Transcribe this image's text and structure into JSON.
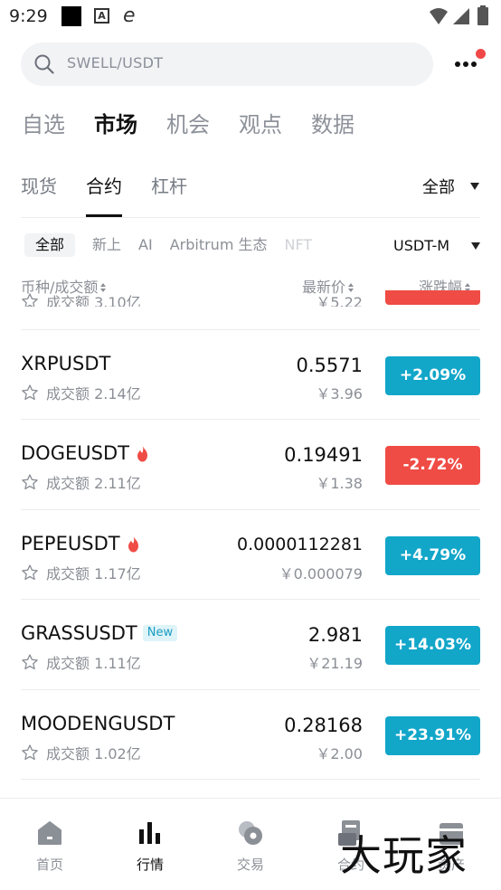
{
  "status_bar": {
    "time": "9:29"
  },
  "search": {
    "placeholder": "SWELL/USDT"
  },
  "main_tabs": [
    {
      "label": "自选",
      "active": false
    },
    {
      "label": "市场",
      "active": true
    },
    {
      "label": "机会",
      "active": false
    },
    {
      "label": "观点",
      "active": false
    },
    {
      "label": "数据",
      "active": false
    }
  ],
  "sub_tabs": [
    {
      "label": "现货",
      "active": false
    },
    {
      "label": "合约",
      "active": true
    },
    {
      "label": "杠杆",
      "active": false
    }
  ],
  "filter_all": "全部",
  "chips": [
    {
      "label": "全部",
      "active": true
    },
    {
      "label": "新上",
      "active": false
    },
    {
      "label": "AI",
      "active": false
    },
    {
      "label": "Arbitrum 生态",
      "active": false
    },
    {
      "label": "NFT",
      "active": false
    }
  ],
  "usdt_m": "USDT-M",
  "columns": {
    "name": "币种/成交额",
    "price": "最新价",
    "change": "涨跌幅"
  },
  "partial_row": {
    "volume": "成交额 3.10亿",
    "cny": "￥5.22"
  },
  "rows": [
    {
      "symbol": "XRPUSDT",
      "hot": false,
      "new": false,
      "volume": "成交额 2.14亿",
      "price": "0.5571",
      "cny": "￥3.96",
      "change": "+2.09%",
      "direction": "up"
    },
    {
      "symbol": "DOGEUSDT",
      "hot": true,
      "new": false,
      "volume": "成交额 2.11亿",
      "price": "0.19491",
      "cny": "￥1.38",
      "change": "-2.72%",
      "direction": "down"
    },
    {
      "symbol": "PEPEUSDT",
      "hot": true,
      "new": false,
      "volume": "成交额 1.17亿",
      "price": "0.0000112281",
      "cny": "￥0.000079",
      "change": "+4.79%",
      "direction": "up"
    },
    {
      "symbol": "GRASSUSDT",
      "hot": false,
      "new": true,
      "new_label": "New",
      "volume": "成交额 1.11亿",
      "price": "2.981",
      "cny": "￥21.19",
      "change": "+14.03%",
      "direction": "up"
    },
    {
      "symbol": "MOODENGUSDT",
      "hot": false,
      "new": false,
      "volume": "成交额 1.02亿",
      "price": "0.28168",
      "cny": "￥2.00",
      "change": "+23.91%",
      "direction": "up"
    }
  ],
  "colors": {
    "up": "#12a6c9",
    "down": "#ef4c45"
  },
  "nav": [
    {
      "label": "首页",
      "icon": "home-icon",
      "active": false
    },
    {
      "label": "行情",
      "icon": "market-chart-icon",
      "active": true
    },
    {
      "label": "交易",
      "icon": "trade-icon",
      "active": false
    },
    {
      "label": "合约",
      "icon": "futures-icon",
      "active": false
    },
    {
      "label": "资产",
      "icon": "wallet-icon",
      "active": false
    }
  ],
  "watermark": "大玩家"
}
